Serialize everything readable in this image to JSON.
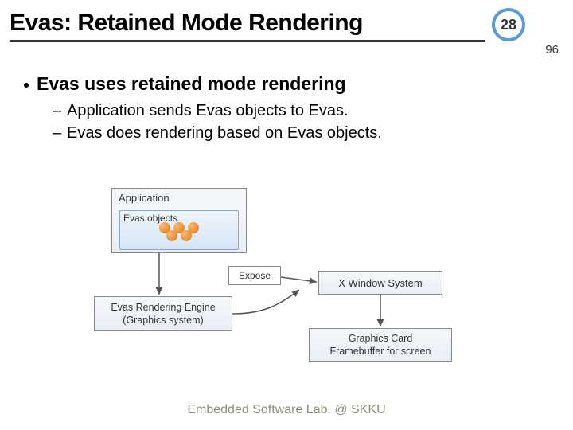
{
  "title": "Evas: Retained Mode Rendering",
  "page_current": "28",
  "page_total": "96",
  "bullet_main": "Evas uses retained mode rendering",
  "sub_bullets": [
    "Application sends Evas objects to Evas.",
    "Evas does rendering based on Evas objects."
  ],
  "diagram": {
    "application": "Application",
    "evas_objects": "Evas objects",
    "expose": "Expose",
    "engine_line1": "Evas Rendering Engine",
    "engine_line2": "(Graphics system)",
    "xwindow": "X Window System",
    "gfx_line1": "Graphics Card",
    "gfx_line2": "Framebuffer for screen"
  },
  "footer": "Embedded Software Lab. @ SKKU"
}
